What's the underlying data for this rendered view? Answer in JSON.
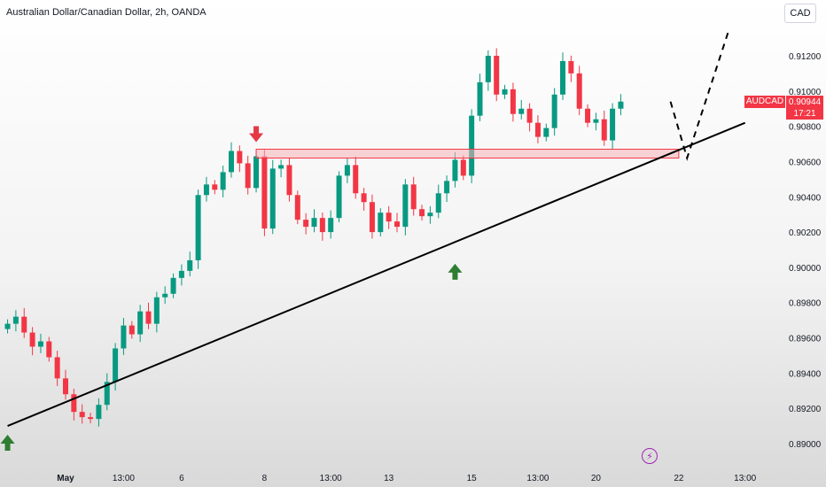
{
  "header": {
    "title": "Australian Dollar/Canadian Dollar, 2h, OANDA",
    "currency_button": "CAD"
  },
  "price_tag": {
    "symbol": "AUDCAD",
    "price": "0.90944",
    "countdown": "17:21",
    "color": "#f23645"
  },
  "colors": {
    "up": "#089981",
    "down": "#f23645",
    "zone_fill": "#f6b3b8",
    "trendline": "#000000",
    "arrow_up": "#2e7d32",
    "arrow_down": "#e53946"
  },
  "icons": {
    "flash": "lightning-icon"
  },
  "chart_data": {
    "type": "candlestick",
    "title": "Australian Dollar/Canadian Dollar, 2h, OANDA",
    "xlabel": "",
    "ylabel": "",
    "ylim": [
      0.889,
      0.9135
    ],
    "x_ticks": [
      "May",
      "13:00",
      "6",
      "8",
      "13:00",
      "13",
      "15",
      "13:00",
      "20",
      "22",
      "13:00"
    ],
    "x_tick_index": [
      0,
      7,
      14,
      24,
      32,
      39,
      49,
      57,
      64,
      74,
      82
    ],
    "y_ticks": [
      "0.91200",
      "0.91000",
      "0.90800",
      "0.90600",
      "0.90400",
      "0.90200",
      "0.90000",
      "0.89800",
      "0.89600",
      "0.89400",
      "0.89200",
      "0.89000"
    ],
    "y_tick_values": [
      0.912,
      0.91,
      0.908,
      0.906,
      0.904,
      0.902,
      0.9,
      0.898,
      0.896,
      0.894,
      0.892,
      0.89
    ],
    "grid": false,
    "candles_start_index": -7,
    "closes": [
      0.8968,
      0.8972,
      0.8963,
      0.8955,
      0.8958,
      0.8949,
      0.8937,
      0.8928,
      0.8918,
      0.8915,
      0.8914,
      0.8922,
      0.8935,
      0.8954,
      0.8967,
      0.8962,
      0.8975,
      0.8968,
      0.8983,
      0.8985,
      0.8994,
      0.8998,
      0.9004,
      0.9041,
      0.9047,
      0.9044,
      0.9054,
      0.9066,
      0.9059,
      0.9045,
      0.9063,
      0.9022,
      0.9056,
      0.9058,
      0.9041,
      0.9027,
      0.9023,
      0.9028,
      0.902,
      0.9028,
      0.9052,
      0.9058,
      0.9042,
      0.9037,
      0.902,
      0.9031,
      0.9026,
      0.9023,
      0.9047,
      0.9033,
      0.9029,
      0.9031,
      0.9042,
      0.9049,
      0.9061,
      0.9052,
      0.9086,
      0.9105,
      0.912,
      0.9098,
      0.9101,
      0.9087,
      0.909,
      0.9082,
      0.9074,
      0.9079,
      0.9098,
      0.9117,
      0.911,
      0.909,
      0.9082,
      0.9084,
      0.9072,
      0.909,
      0.9094
    ],
    "trendline": {
      "from": {
        "x": -7,
        "y": 0.891
      },
      "to": {
        "x": 82,
        "y": 0.9082
      }
    },
    "resistance_zone": {
      "x_from": 23,
      "x_to": 74,
      "y_low": 0.9062,
      "y_high": 0.9067
    },
    "projection": [
      {
        "x": 73,
        "y": 0.9094
      },
      {
        "x": 75,
        "y": 0.9062
      },
      {
        "x": 80,
        "y": 0.9134
      }
    ],
    "markers": [
      {
        "type": "arrow-down",
        "x": 23,
        "y": 0.907
      },
      {
        "type": "arrow-up",
        "x": -7,
        "y": 0.8905
      },
      {
        "type": "arrow-up",
        "x": 47,
        "y": 0.9002
      }
    ]
  }
}
